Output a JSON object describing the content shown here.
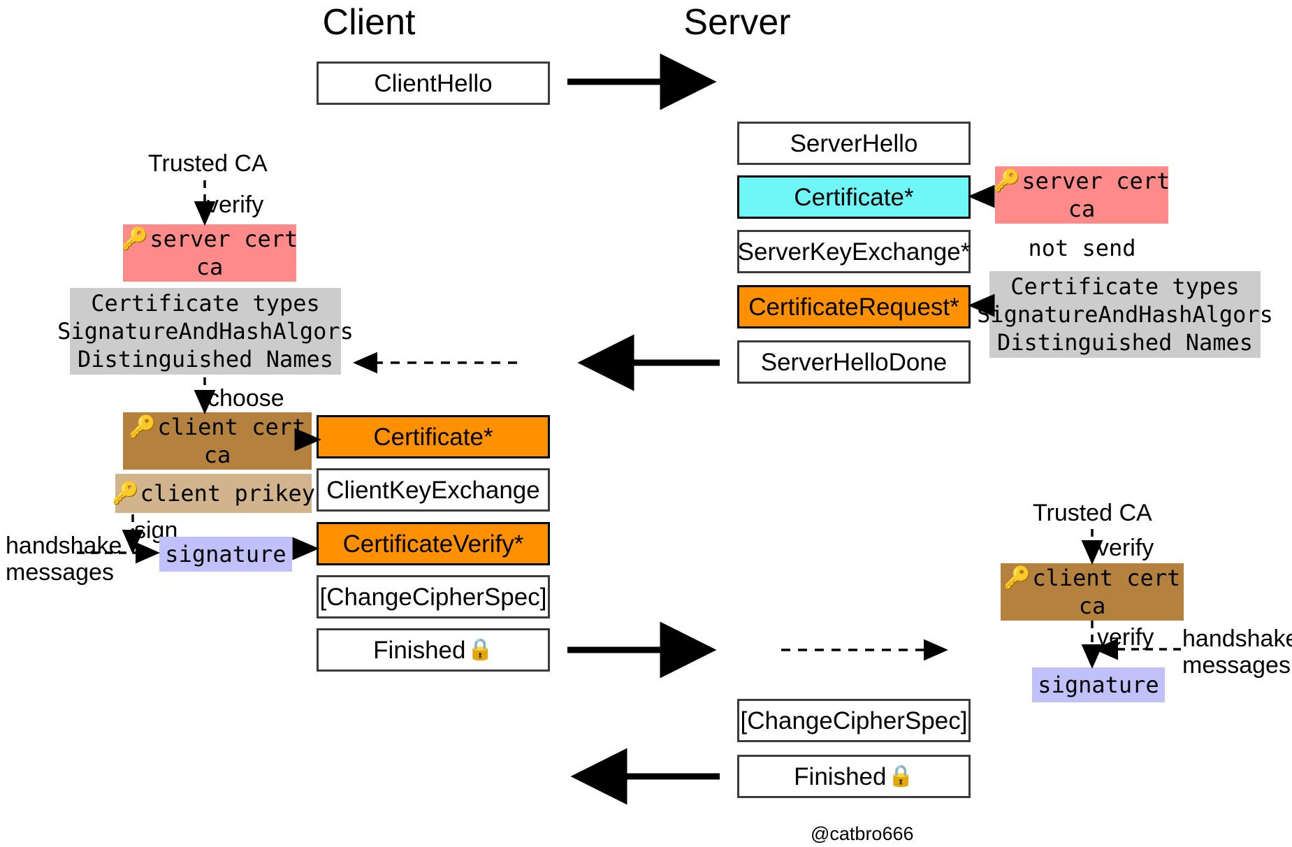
{
  "diagram": {
    "title_left": "Client",
    "title_right": "Server",
    "footer": "@catbro666",
    "colors": {
      "white": "#ffffff",
      "cyan": "#6ff7f7",
      "orange": "#ff9000",
      "red": "#ff8a8a",
      "grey": "#cccccc",
      "brown": "#b5813f",
      "tan": "#d2b48c",
      "violet": "#c0c0fa",
      "border": "#3b3b3b"
    }
  },
  "client_messages": [
    {
      "label": "ClientHello",
      "style": "white"
    },
    {
      "label": "Certificate*",
      "style": "orange"
    },
    {
      "label": "ClientKeyExchange",
      "style": "white"
    },
    {
      "label": "CertificateVerify*",
      "style": "orange"
    },
    {
      "label": "[ChangeCipherSpec]",
      "style": "white"
    },
    {
      "label": "Finished",
      "style": "white",
      "icon": "lock-icon",
      "glyph": "🔒"
    }
  ],
  "server_messages": [
    {
      "label": "ServerHello",
      "style": "white"
    },
    {
      "label": "Certificate*",
      "style": "cyan"
    },
    {
      "label": "ServerKeyExchange*",
      "style": "white"
    },
    {
      "label": "CertificateRequest*",
      "style": "orange"
    },
    {
      "label": "ServerHelloDone",
      "style": "white"
    },
    {
      "label": "[ChangeCipherSpec]",
      "style": "white"
    },
    {
      "label": "Finished",
      "style": "white",
      "icon": "lock-icon",
      "glyph": "🔒"
    }
  ],
  "client_side": {
    "trusted_ca": "Trusted CA",
    "verify_label": "verify",
    "server_cert": {
      "line1": "server cert",
      "line2": "ca",
      "icon": "key-icon",
      "glyph": "🔑"
    },
    "cert_request_params": [
      "Certificate types",
      "SignatureAndHashAlgors",
      "Distinguished Names"
    ],
    "choose_label": "choose",
    "client_cert": {
      "line1": "client cert",
      "line2": "ca",
      "icon": "key-icon",
      "glyph": "🔑"
    },
    "client_prikey": {
      "line1": "client prikey",
      "icon": "key-icon",
      "glyph": "🔑"
    },
    "sign_label": "sign",
    "handshake_messages": "handshake\nmessages",
    "signature": "signature"
  },
  "server_side": {
    "server_cert": {
      "line1": "server cert",
      "line2": "ca",
      "icon": "key-icon",
      "glyph": "🔑"
    },
    "not_send": "not send",
    "cert_request_params": [
      "Certificate types",
      "SignatureAndHashAlgors",
      "Distinguished Names"
    ],
    "trusted_ca": "Trusted CA",
    "verify_label_top": "verify",
    "client_cert": {
      "line1": "client cert",
      "line2": "ca",
      "icon": "key-icon",
      "glyph": "🔑"
    },
    "verify_label_bottom": "verify",
    "handshake_messages": "handshake\nmessages",
    "signature": "signature"
  }
}
